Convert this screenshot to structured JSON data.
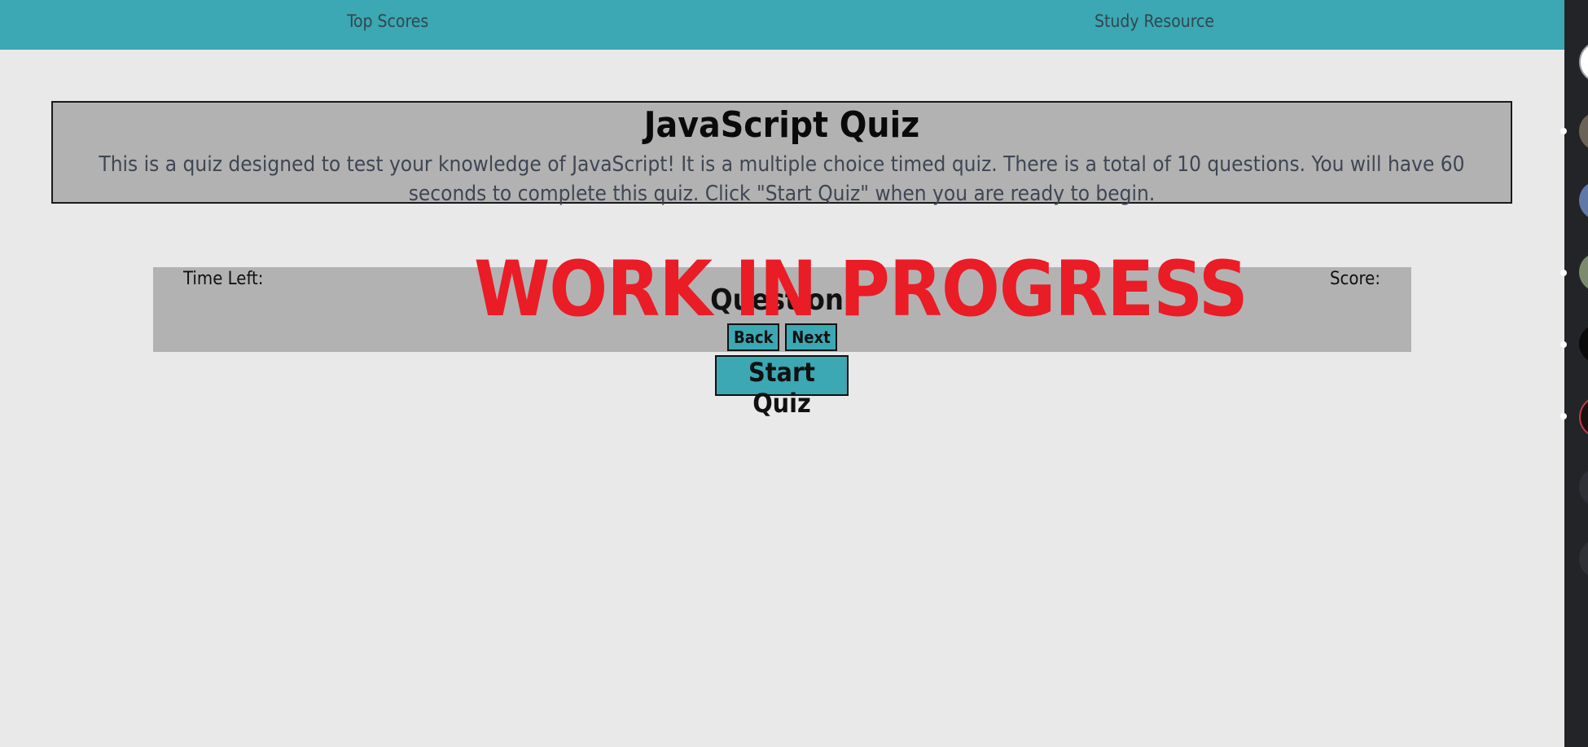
{
  "nav": {
    "top_scores": "Top Scores",
    "study_resource": "Study Resource"
  },
  "intro": {
    "title": "JavaScript Quiz",
    "description": "This is a quiz designed to test your knowledge of JavaScript! It is a multiple choice timed quiz. There is a total of 10 questions. You will have 60 seconds to complete this quiz. Click \"Start Quiz\" when you are ready to begin."
  },
  "quiz": {
    "time_left_label": "Time Left:",
    "score_label": "Score:",
    "question_label": "Question:",
    "back_label": "Back",
    "next_label": "Next",
    "start_label": "Start Quiz"
  },
  "overlay": {
    "banner_text": "WORK IN PROGRESS"
  },
  "sidebar": {
    "icons": [
      "server-icon",
      "avatar",
      "avatar",
      "avatar",
      "avatar",
      "avatar",
      "avatar",
      "avatar"
    ]
  },
  "colors": {
    "nav_bg": "#3ba8b3",
    "page_bg": "#e9e9e9",
    "panel_bg": "#b2b2b2",
    "button_bg": "#3ba8b3",
    "banner_red": "#ea1c26",
    "sidebar_bg": "#232428"
  }
}
